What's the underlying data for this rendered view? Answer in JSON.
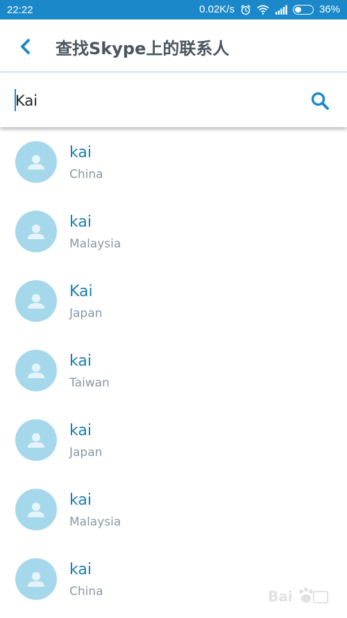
{
  "status_bar": {
    "time": "22:22",
    "speed": "0.02K/s",
    "battery_percent": "36%",
    "battery_level": 0.36,
    "icons": [
      "alarm-icon",
      "wifi-icon",
      "signal-icon",
      "battery-icon"
    ]
  },
  "header": {
    "back_icon": "chevron-left-icon",
    "title": "查找Skype上的联系人"
  },
  "search": {
    "value": "Kai",
    "icon": "search-icon"
  },
  "results": [
    {
      "name": "kai",
      "location": "China"
    },
    {
      "name": "kai",
      "location": "Malaysia"
    },
    {
      "name": "Kai",
      "location": "Japan"
    },
    {
      "name": "kai",
      "location": "Taiwan"
    },
    {
      "name": "kai",
      "location": "Japan"
    },
    {
      "name": "kai",
      "location": "Malaysia"
    },
    {
      "name": "kai",
      "location": "China"
    }
  ],
  "colors": {
    "status_bar": "#1a88c9",
    "accent": "#1a88c9",
    "name_text": "#1a7fb0",
    "avatar_bg": "#a6d8ec",
    "secondary_text": "#8a98a4"
  }
}
